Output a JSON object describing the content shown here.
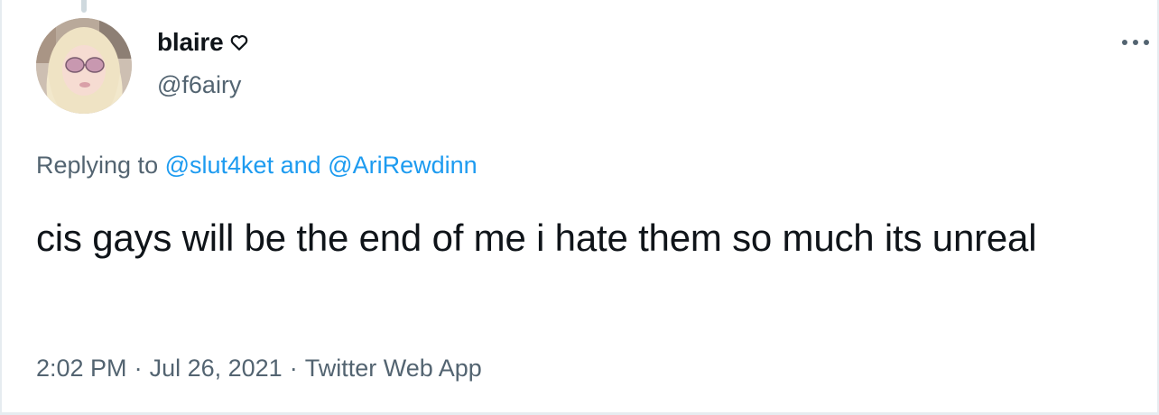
{
  "tweet": {
    "author": {
      "display_name": "blaire",
      "handle": "@f6airy",
      "name_icon": "heart-outline-icon"
    },
    "reply_context": {
      "prefix": "Replying to",
      "mentions": [
        "@slut4ket",
        "@AriRewdinn"
      ],
      "conjunction": "and"
    },
    "text": "cis gays will be the end of me i hate them so much its unreal",
    "meta": {
      "time": "2:02 PM",
      "separator": "·",
      "date": "Jul 26, 2021",
      "source": "Twitter Web App"
    },
    "menu_icon": "more-options-icon"
  },
  "colors": {
    "text_primary": "#0f1419",
    "text_secondary": "#536471",
    "link": "#1d9bf0",
    "border": "#e6ecf0"
  }
}
